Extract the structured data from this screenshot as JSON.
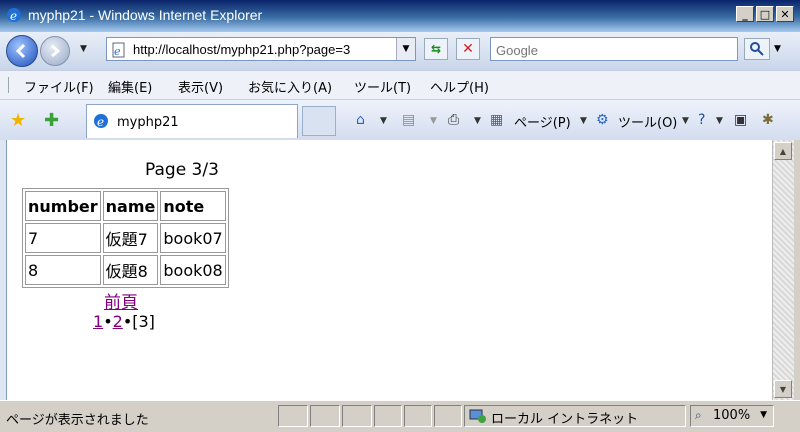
{
  "window": {
    "title": "myphp21 - Windows Internet Explorer"
  },
  "address": {
    "url": "http://localhost/myphp21.php?page=3"
  },
  "search": {
    "placeholder": "Google"
  },
  "menu": {
    "items": [
      "ファイル(F)",
      "編集(E)",
      "表示(V)",
      "お気に入り(A)",
      "ツール(T)",
      "ヘルプ(H)"
    ]
  },
  "tab": {
    "label": "myphp21"
  },
  "toolbar": {
    "page_label": "ページ(P)",
    "tools_label": "ツール(O)"
  },
  "content": {
    "page_header": "Page 3/3",
    "table": {
      "headers": [
        "number",
        "name",
        "note"
      ],
      "rows": [
        [
          "7",
          "仮題7",
          "book07"
        ],
        [
          "8",
          "仮題8",
          "book08"
        ]
      ]
    },
    "prev_link": "前頁",
    "pager": {
      "links": [
        "1",
        "2"
      ],
      "separator": "•",
      "current": "[3]"
    }
  },
  "status": {
    "text": "ページが表示されました",
    "zone": "ローカル イントラネット",
    "zoom": "100%"
  },
  "colors": {
    "visited_link": "#800080",
    "title_bar": "#0a246a"
  }
}
